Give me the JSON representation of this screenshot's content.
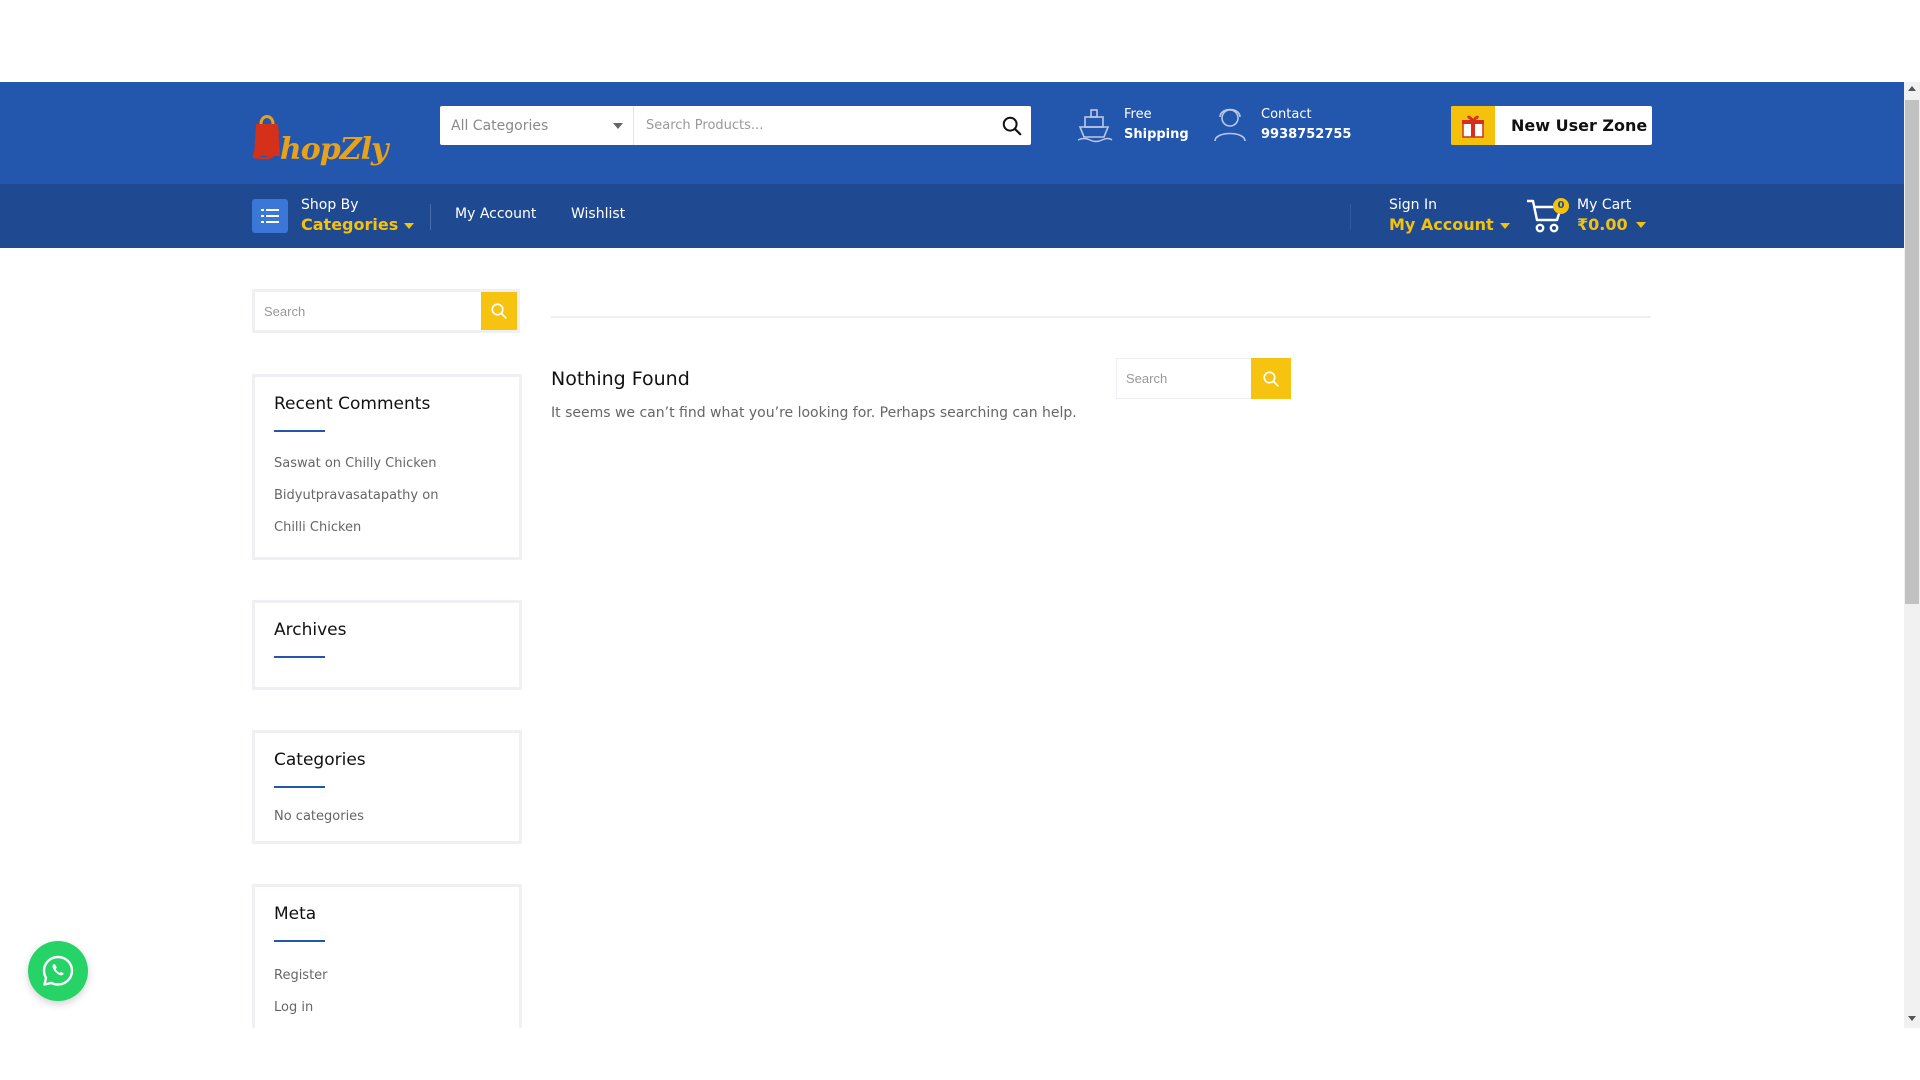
{
  "brand": {
    "name_initial": "S",
    "name_rest": "hopZly"
  },
  "search": {
    "category_label": "All Categories",
    "placeholder": "Search Products..."
  },
  "header_info": {
    "shipping": {
      "line1": "Free",
      "line2": "Shipping",
      "icon": "ship-icon"
    },
    "contact": {
      "line1": "Contact",
      "line2": "9938752755",
      "icon": "support-agent-icon"
    }
  },
  "new_user": {
    "label": "New User Zone",
    "icon": "gift-icon"
  },
  "nav": {
    "shop_by": "Shop By",
    "categories": "Categories",
    "links": [
      "My Account",
      "Wishlist"
    ],
    "sign_in": "Sign In",
    "my_account": "My Account",
    "cart_label": "My Cart",
    "cart_amount": "₹0.00",
    "cart_count": "0"
  },
  "sidebar": {
    "search_placeholder": "Search",
    "recent_comments": {
      "title": "Recent Comments",
      "items": [
        {
          "author": "Saswat",
          "on": "on",
          "post": "Chilly Chicken"
        },
        {
          "author": "Bidyutpravasatapathy",
          "on": "on",
          "post": "Chilli Chicken"
        }
      ]
    },
    "archives": {
      "title": "Archives"
    },
    "categories": {
      "title": "Categories",
      "empty": "No categories"
    },
    "meta": {
      "title": "Meta",
      "links": [
        "Register",
        "Log in"
      ]
    }
  },
  "main": {
    "title": "Nothing Found",
    "message": "It seems we can’t find what you’re looking for. Perhaps searching can help.",
    "search_placeholder": "Search"
  },
  "colors": {
    "header": "#2356ad",
    "nav": "#1f4a92",
    "accent": "#f4c20d",
    "whatsapp": "#25d366"
  }
}
